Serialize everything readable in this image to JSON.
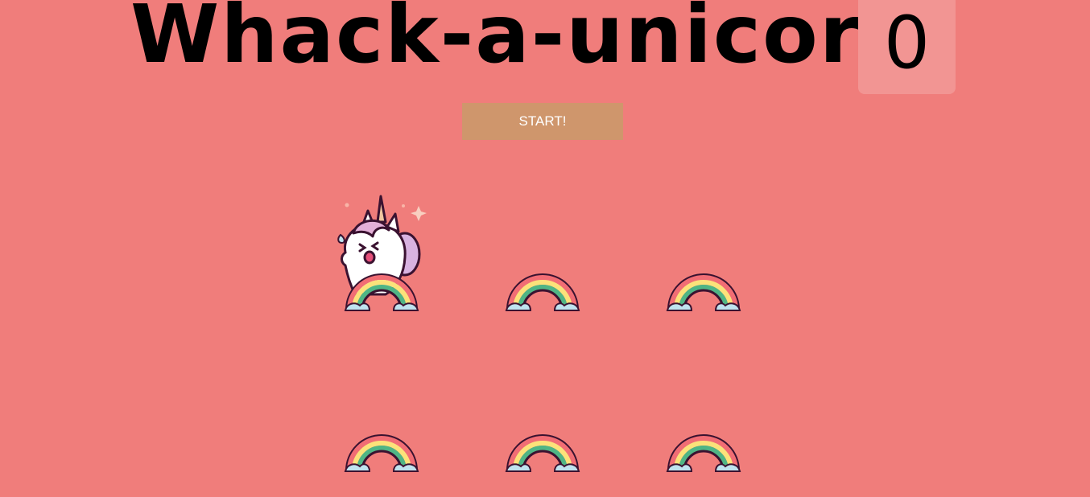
{
  "game": {
    "title": "Whack-a-unicorn!",
    "score": "0",
    "start_label": "START!",
    "active_hole": 0,
    "hole_count": 6
  },
  "colors": {
    "background": "#f07d7b",
    "score_box": "#f29593",
    "start_button": "#cf966c",
    "rainbow_red": "#f16d74",
    "rainbow_yellow": "#fce27a",
    "rainbow_green": "#4fb585",
    "cloud": "#bfe3ef"
  },
  "icons": {
    "hole": "rainbow-icon",
    "mole": "unicorn-icon"
  }
}
